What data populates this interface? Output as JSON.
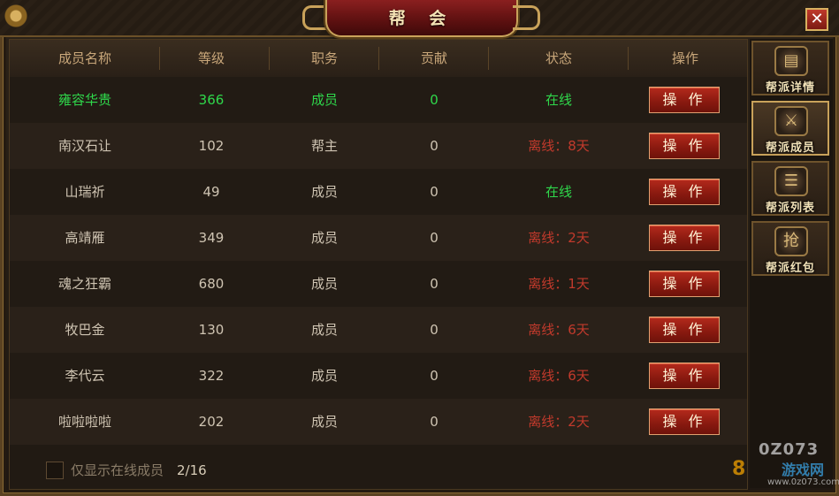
{
  "window": {
    "title": "帮 会",
    "close_icon": "✕"
  },
  "table": {
    "headers": [
      "成员名称",
      "等级",
      "职务",
      "贡献",
      "状态",
      "操作"
    ],
    "rows": [
      {
        "name": "雍容华贵",
        "level": "366",
        "role": "成员",
        "contribution": "0",
        "status": "在线",
        "status_type": "online",
        "highlight": true,
        "action": "操 作"
      },
      {
        "name": "南汉石让",
        "level": "102",
        "role": "帮主",
        "contribution": "0",
        "status": "离线：8天",
        "status_type": "offline",
        "highlight": false,
        "action": "操 作"
      },
      {
        "name": "山瑞祈",
        "level": "49",
        "role": "成员",
        "contribution": "0",
        "status": "在线",
        "status_type": "online",
        "highlight": false,
        "action": "操 作"
      },
      {
        "name": "高靖雁",
        "level": "349",
        "role": "成员",
        "contribution": "0",
        "status": "离线：2天",
        "status_type": "offline",
        "highlight": false,
        "action": "操 作"
      },
      {
        "name": "魂之狂霸",
        "level": "680",
        "role": "成员",
        "contribution": "0",
        "status": "离线：1天",
        "status_type": "offline",
        "highlight": false,
        "action": "操 作"
      },
      {
        "name": "牧巴金",
        "level": "130",
        "role": "成员",
        "contribution": "0",
        "status": "离线：6天",
        "status_type": "offline",
        "highlight": false,
        "action": "操 作"
      },
      {
        "name": "李代云",
        "level": "322",
        "role": "成员",
        "contribution": "0",
        "status": "离线：6天",
        "status_type": "offline",
        "highlight": false,
        "action": "操 作"
      },
      {
        "name": "啦啦啦啦",
        "level": "202",
        "role": "成员",
        "contribution": "0",
        "status": "离线：2天",
        "status_type": "offline",
        "highlight": false,
        "action": "操 作"
      }
    ]
  },
  "footer": {
    "checkbox_label": "仅显示在线成员",
    "count": "2/16"
  },
  "side_tabs": [
    {
      "label": "帮派详情",
      "icon": "book-icon",
      "glyph": "▤",
      "active": false
    },
    {
      "label": "帮派成员",
      "icon": "warrior-icon",
      "glyph": "⚔",
      "active": true
    },
    {
      "label": "帮派列表",
      "icon": "scroll-icon",
      "glyph": "☰",
      "active": false
    },
    {
      "label": "帮派红包",
      "icon": "red-envelope-icon",
      "glyph": "抢",
      "active": false
    }
  ],
  "watermark": {
    "top": "0Z073",
    "mid": "8",
    "cn": "游戏网",
    "url": "www.0z073.com"
  },
  "colors": {
    "online": "#2fd84b",
    "offline": "#c23a2c",
    "accent": "#c9a25a"
  }
}
